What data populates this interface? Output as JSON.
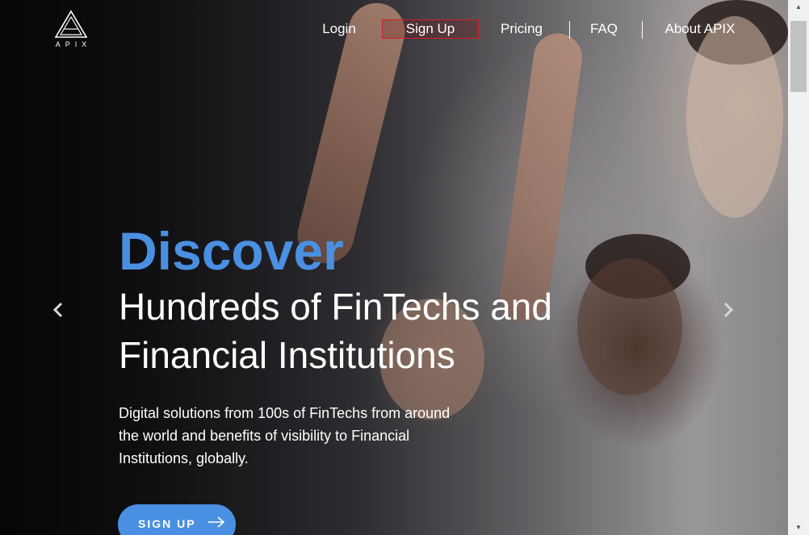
{
  "logo": {
    "text": "APIX"
  },
  "nav": {
    "login": "Login",
    "signup": "Sign Up",
    "pricing": "Pricing",
    "faq": "FAQ",
    "about": "About APIX"
  },
  "hero": {
    "discover": "Discover",
    "headline": "Hundreds of FinTechs and Financial Institutions",
    "subtext": "Digital solutions from 100s of FinTechs from around the world and benefits of visibility to Financial Institutions, globally.",
    "cta_label": "SIGN UP"
  },
  "carousel": {
    "prev_icon": "‹",
    "next_icon": "›"
  },
  "icons": {
    "logo": "apix-logo-icon",
    "prev": "chevron-left-icon",
    "next": "chevron-right-icon",
    "cta": "arrow-right-icon"
  },
  "colors": {
    "accent_blue": "#4a90e2",
    "signup_border": "#d41f2a",
    "nav_text": "#ffffff"
  }
}
